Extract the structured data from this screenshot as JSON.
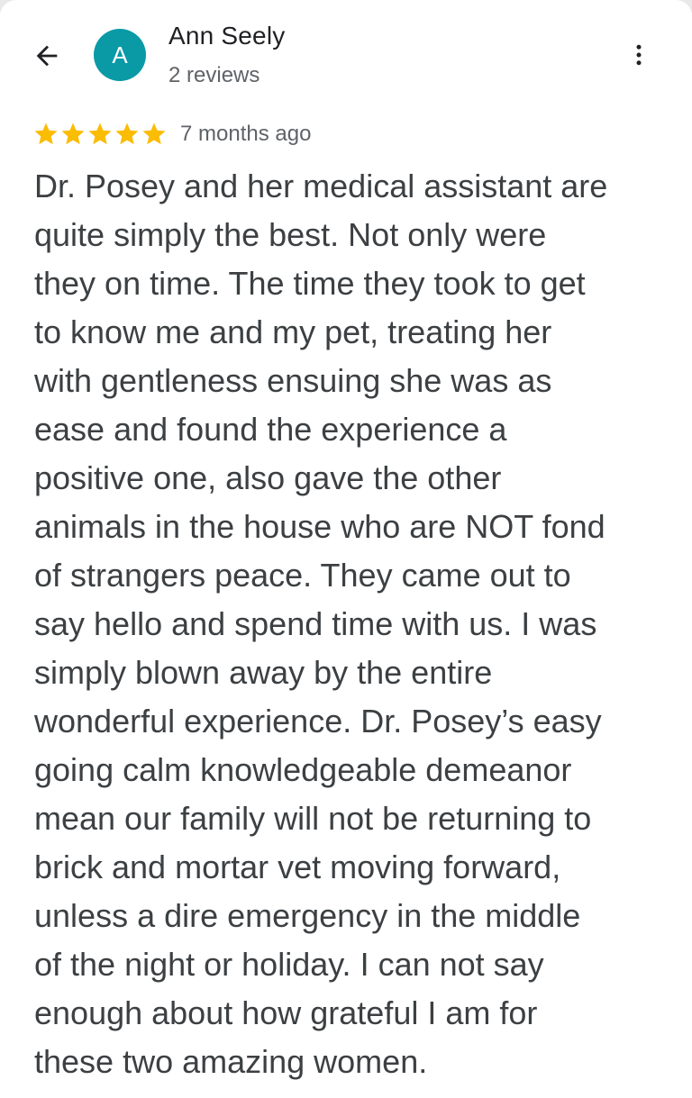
{
  "reviewer": {
    "avatar_initial": "A",
    "name": "Ann Seely",
    "review_count": "2 reviews"
  },
  "review": {
    "stars": 5,
    "max_stars": 5,
    "time_ago": "7 months ago",
    "text": "Dr. Posey and her medical assistant are\nquite simply the best. Not only were\nthey on time. The time they took to get\nto know me and my pet, treating her\nwith gentleness ensuing she was as\nease and found the experience a\npositive one, also gave the other\nanimals in the house who are NOT fond\nof strangers peace. They came out to\nsay hello and spend time with us. I was\nsimply blown away by the entire\nwonderful experience. Dr. Posey’s easy\ngoing calm knowledgeable demeanor\nmean our family will not be returning to\nbrick and mortar vet moving forward,\nunless a dire emergency in the middle\nof the night or holiday. I can not say\nenough about how grateful I am for\nthese two amazing women."
  },
  "icons": {
    "back": "arrow-back-icon",
    "menu": "more-vert-icon",
    "star": "star-icon"
  },
  "colors": {
    "avatar_bg": "#0a9aa6",
    "star": "#fbbc04",
    "text": "#3c4043",
    "secondary_text": "#5f6368"
  }
}
